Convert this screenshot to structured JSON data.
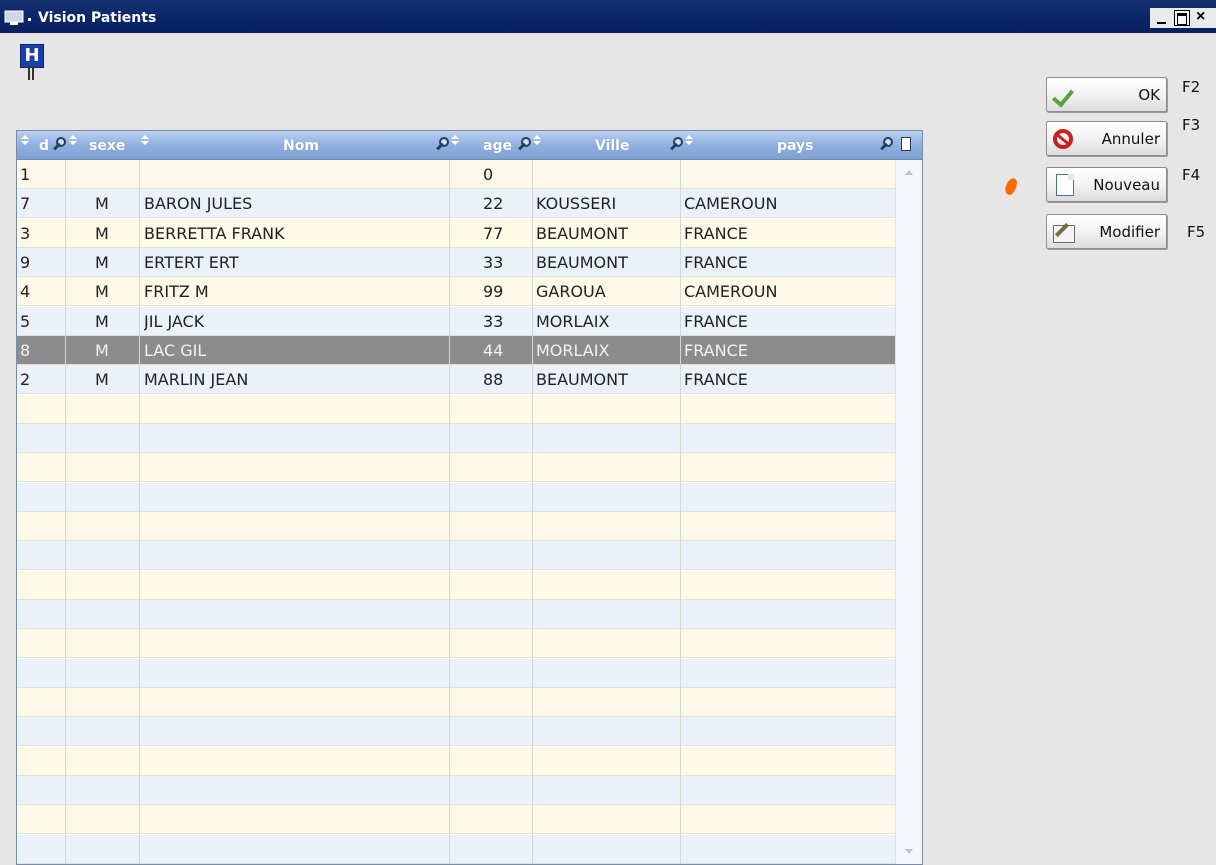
{
  "window": {
    "title": "Vision Patients"
  },
  "grid": {
    "columns": [
      {
        "key": "id",
        "label": "d"
      },
      {
        "key": "sexe",
        "label": "sexe"
      },
      {
        "key": "nom",
        "label": "Nom"
      },
      {
        "key": "age",
        "label": "age"
      },
      {
        "key": "ville",
        "label": "Ville"
      },
      {
        "key": "pays",
        "label": "pays"
      }
    ],
    "rows": [
      {
        "id": "1",
        "sexe": "",
        "nom": "",
        "age": "0",
        "ville": "",
        "pays": ""
      },
      {
        "id": "7",
        "sexe": "M",
        "nom": "BARON JULES",
        "age": "22",
        "ville": "KOUSSERI",
        "pays": "CAMEROUN"
      },
      {
        "id": "3",
        "sexe": "M",
        "nom": "BERRETTA FRANK",
        "age": "77",
        "ville": "BEAUMONT",
        "pays": "FRANCE"
      },
      {
        "id": "9",
        "sexe": "M",
        "nom": "ERTERT ERT",
        "age": "33",
        "ville": "BEAUMONT",
        "pays": "FRANCE"
      },
      {
        "id": "4",
        "sexe": "M",
        "nom": "FRITZ M",
        "age": "99",
        "ville": "GAROUA",
        "pays": "CAMEROUN"
      },
      {
        "id": "5",
        "sexe": "M",
        "nom": "JIL JACK",
        "age": "33",
        "ville": "MORLAIX",
        "pays": "FRANCE"
      },
      {
        "id": "8",
        "sexe": "M",
        "nom": "LAC GIL",
        "age": "44",
        "ville": "MORLAIX",
        "pays": "FRANCE"
      },
      {
        "id": "2",
        "sexe": "M",
        "nom": "MARLIN JEAN",
        "age": "88",
        "ville": "BEAUMONT",
        "pays": "FRANCE"
      }
    ],
    "selected_row_index": 6
  },
  "buttons": [
    {
      "label": "OK",
      "shortcut": "F2",
      "icon": "check-icon"
    },
    {
      "label": "Annuler",
      "shortcut": "F3",
      "icon": "cancel-icon"
    },
    {
      "label": "Nouveau",
      "shortcut": "F4",
      "icon": "new-document-icon"
    },
    {
      "label": "Modifier",
      "shortcut": "F5",
      "icon": "edit-icon"
    }
  ],
  "logo": {
    "text": "H"
  },
  "colors": {
    "titlebar": "#0a246a",
    "header": "#8fb1e0",
    "selected_row": "#8c8c8c",
    "odd_row": "#fcf9e6",
    "even_row": "#ebf1f8"
  }
}
